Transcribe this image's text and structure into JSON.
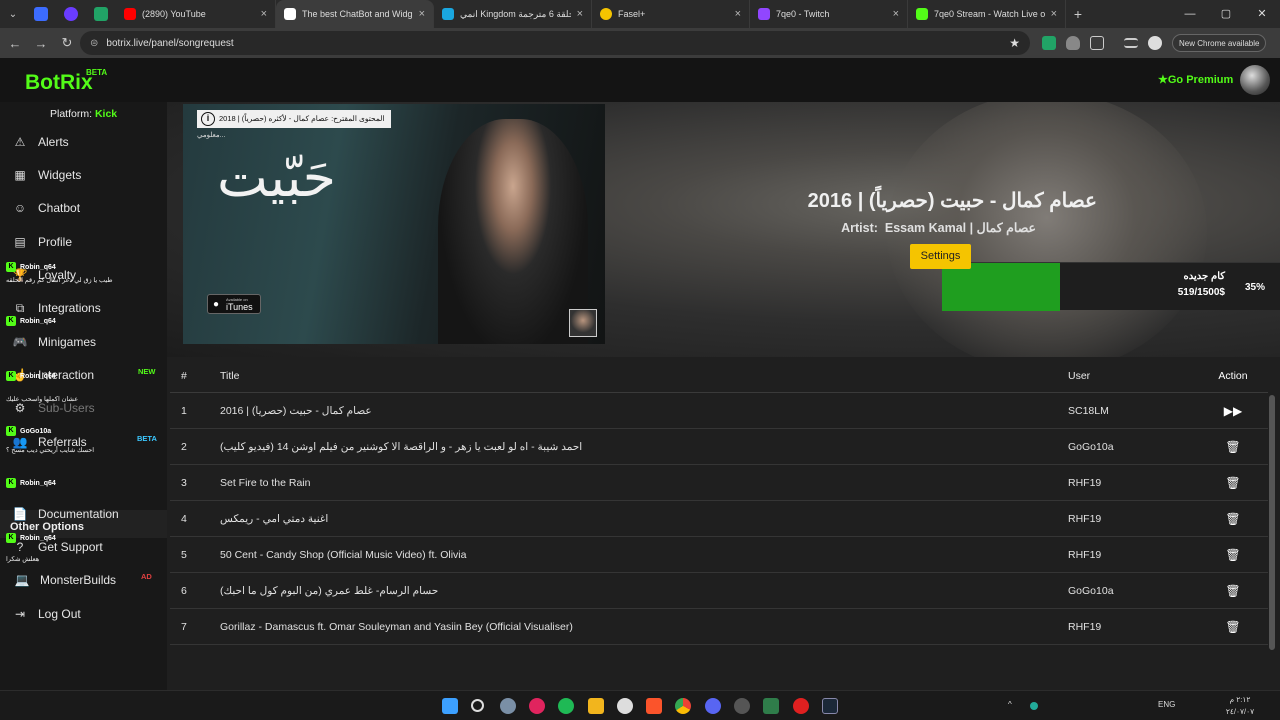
{
  "browser": {
    "tabs": [
      {
        "label": "(2890) YouTube",
        "color": "#ff0000",
        "close": "×"
      },
      {
        "label": "The best ChatBot and Widg",
        "color": "#ffffff",
        "close": "×",
        "active": true
      },
      {
        "label": "انمي Kingdom الحلقة 6 مترجمة",
        "color": "#1aa7e0",
        "close": "×"
      },
      {
        "label": "Fasel+",
        "color": "#f5c400",
        "close": "×"
      },
      {
        "label": "7qe0 - Twitch",
        "color": "#9146ff",
        "close": "×"
      },
      {
        "label": "7qe0 Stream - Watch Live on K",
        "color": "#53fc18",
        "close": "×"
      }
    ],
    "url": "botrix.live/panel/songrequest",
    "new_chrome_label": "New Chrome available",
    "new_tab": "+",
    "menu_chevron": "⌄",
    "back": "←",
    "forward": "→",
    "reload": "↻",
    "star": "★",
    "lock": "⊜",
    "window_controls": {
      "minimize": "—",
      "maximize": "▢",
      "close": "✕"
    }
  },
  "header": {
    "logo": "BotRix",
    "logo_badge": "BETA",
    "premium_label": "Go Premium",
    "premium_icon": "★"
  },
  "sidebar": {
    "platform_label": "Platform:",
    "platform_value": "Kick",
    "items": [
      {
        "label": "Alerts",
        "icon": "⚠"
      },
      {
        "label": "Widgets",
        "icon": "▦"
      },
      {
        "label": "Chatbot",
        "icon": "☺"
      },
      {
        "label": "Profile",
        "icon": "▤"
      },
      {
        "label": "Loyalty",
        "icon": "🏆"
      },
      {
        "label": "Integrations",
        "icon": "⧉"
      },
      {
        "label": "Minigames",
        "icon": "🎮"
      },
      {
        "label": "Interaction",
        "icon": "☝",
        "badge": "NEW"
      },
      {
        "label": "Sub-Users",
        "icon": "⚙"
      },
      {
        "label": "Referrals",
        "icon": "👥",
        "badge": "BETA"
      },
      {
        "label": "Documentation",
        "icon": "📄"
      },
      {
        "label": "Get Support",
        "icon": "?"
      },
      {
        "label": "MonsterBuilds",
        "icon": "💻",
        "badge": "AD"
      },
      {
        "label": "Log Out",
        "icon": "⇥"
      }
    ],
    "other_options": "Other Options"
  },
  "chat_overlay": [
    {
      "name": "Robin_q64",
      "text": "طيب يا زق لي دعر اسال كم رقم الحلقه"
    },
    {
      "name": "Robin_q64",
      "text": ""
    },
    {
      "name": "Robin_q64",
      "text": "عشان اكملها واسحب عليك"
    },
    {
      "name": "GoGo10a",
      "text": "احسك شايب أريحتي ديب مسح ؟"
    },
    {
      "name": "Robin_q64",
      "text": ""
    },
    {
      "name": "Robin_q64",
      "text": "هعلش شكرا"
    }
  ],
  "now_playing": {
    "title": "عصام كمال - حبيت (حصرياً) | 2016",
    "artist_label": "Artist:",
    "artist": "Essam Kamal | عصام كمال",
    "settings_label": "Settings",
    "thumbnail": {
      "title_art": "حَبّيت",
      "info_text": "المحتوى المقترح: عصام كمال - لأكثره (حصرياً) | 2018",
      "more_text": "معلومي...",
      "itunes_pre": "Available on",
      "itunes_label": "iTunes",
      "info_icon": "i"
    }
  },
  "goal": {
    "name": "كام جديده",
    "amount": "519/1500$",
    "percent": "35%",
    "fraction": 0.35,
    "color": "#1f9e1f"
  },
  "queue": {
    "headers": {
      "num": "#",
      "title": "Title",
      "user": "User",
      "action": "Action"
    },
    "rows": [
      {
        "num": "1",
        "title": "عصام كمال - حبيت (حصرياً) | 2016",
        "user": "SC18LM",
        "action": "▶▶"
      },
      {
        "num": "2",
        "title": "احمد شيبة - اه لو لعبت يا زهر - و الراقصة الا كوشنير من فيلم اوشن 14 (فيديو كليب)",
        "user": "GoGo10a",
        "action": "🗑"
      },
      {
        "num": "3",
        "title": "Set Fire to the Rain",
        "user": "RHF19",
        "action": "🗑"
      },
      {
        "num": "4",
        "title": "اغنية دمتي امي - ريمكس",
        "user": "RHF19",
        "action": "🗑"
      },
      {
        "num": "5",
        "title": "50 Cent - Candy Shop (Official Music Video) ft. Olivia",
        "user": "RHF19",
        "action": "🗑"
      },
      {
        "num": "6",
        "title": "حسام الرسام- غلط عمري (من البوم كول ما احبك)",
        "user": "GoGo10a",
        "action": "🗑"
      },
      {
        "num": "7",
        "title": "Gorillaz - Damascus ft. Omar Souleyman and Yasiin Bey (Official Visualiser)",
        "user": "RHF19",
        "action": "🗑"
      }
    ]
  },
  "taskbar": {
    "language": "ENG",
    "clock_time": "٢:١٢ م",
    "clock_date": "٢٤/٠٧/٠٧",
    "chevron": "^"
  }
}
